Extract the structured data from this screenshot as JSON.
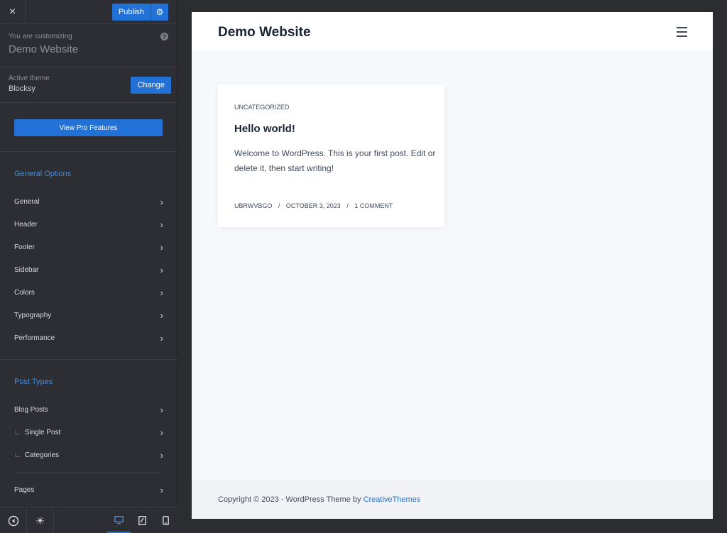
{
  "sidebar": {
    "close_icon": "×",
    "publish_label": "Publish",
    "publish_settings_icon": "⚙",
    "customizing_label": "You are customizing",
    "site_name": "Demo Website",
    "help_icon": "?",
    "active_theme_label": "Active theme",
    "theme_name": "Blocksy",
    "change_label": "Change",
    "pro_button_label": "View Pro Features",
    "general_options_title": "General Options",
    "general_items": [
      "General",
      "Header",
      "Footer",
      "Sidebar",
      "Colors",
      "Typography",
      "Performance"
    ],
    "post_types_title": "Post Types",
    "post_type_items": [
      "Blog Posts",
      "Single Post",
      "Categories"
    ],
    "sub_marker": "∟",
    "pages_label": "Pages",
    "chevron": "›",
    "bottom": {
      "back_icon": "◀",
      "theme_mode_icon": "☀"
    }
  },
  "preview": {
    "site_title": "Demo Website",
    "post": {
      "category": "UNCATEGORIZED",
      "title": "Hello world!",
      "excerpt": "Welcome to WordPress. This is your first post. Edit or delete it, then start writing!",
      "author": "UBRWVBGO",
      "date": "OCTOBER 3, 2023",
      "comments": "1 COMMENT",
      "separator": "/"
    },
    "footer": {
      "text": "Copyright © 2023 - WordPress Theme by ",
      "link": "CreativeThemes"
    }
  },
  "colors": {
    "accent": "#2271d6",
    "sidebar_bg": "#2c2e33",
    "section_title": "#3b8be6"
  }
}
